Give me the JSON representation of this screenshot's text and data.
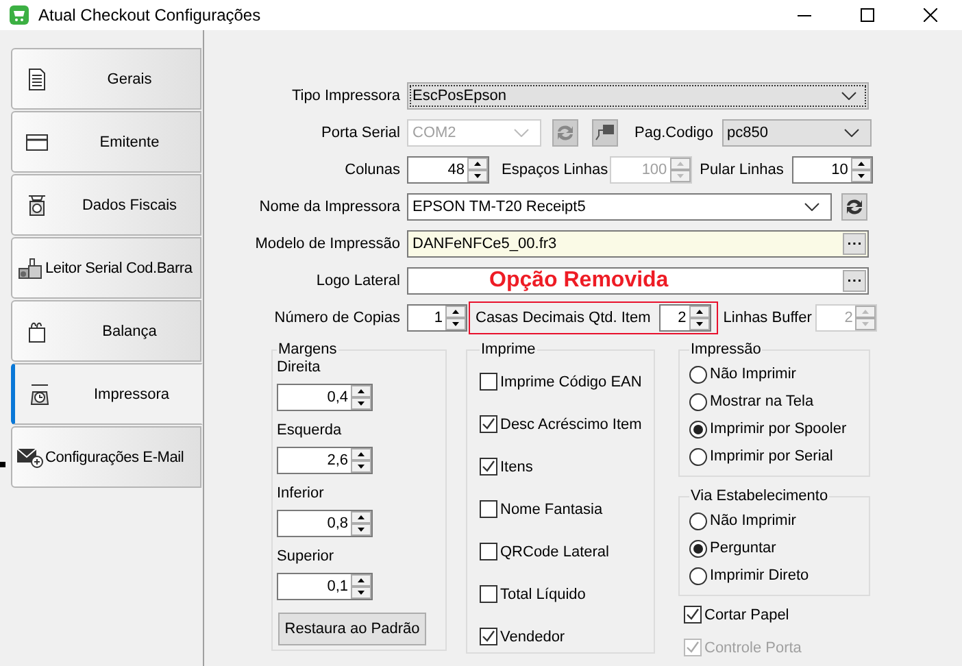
{
  "window": {
    "title": "Atual Checkout Configurações"
  },
  "sidebar": {
    "items": [
      {
        "label": "Gerais",
        "selected": false
      },
      {
        "label": "Emitente",
        "selected": false
      },
      {
        "label": "Dados Fiscais",
        "selected": false
      },
      {
        "label": "Leitor Serial Cod.Barra",
        "selected": false
      },
      {
        "label": "Balança",
        "selected": false
      },
      {
        "label": "Impressora",
        "selected": true
      },
      {
        "label": "Configurações E-Mail",
        "selected": false
      }
    ]
  },
  "printer_type": {
    "label": "Tipo Impressora",
    "value": "EscPosEpson",
    "kind": "list",
    "disabled": false
  },
  "serial_port": {
    "label": "Porta Serial",
    "value": "COM2",
    "disabled": true
  },
  "code_page": {
    "label": "Pag.Codigo",
    "value": "pc850",
    "kind": "list",
    "disabled": false
  },
  "columns": {
    "label": "Colunas",
    "value": "48",
    "disabled": false
  },
  "line_spacing": {
    "label": "Espaços Linhas",
    "value": "100",
    "disabled": true
  },
  "skip_lines": {
    "label": "Pular Linhas",
    "value": "10",
    "disabled": false
  },
  "printer_name": {
    "label": "Nome da Impressora",
    "value": "EPSON TM-T20 Receipt5",
    "kind": "edit",
    "disabled": false
  },
  "print_model": {
    "label": "Modelo de Impressão",
    "value": "DANFeNFCe5_00.fr3"
  },
  "side_logo": {
    "label": "Logo Lateral",
    "annotation": "Opção Removida"
  },
  "copies": {
    "label": "Número de Copias",
    "value": "1",
    "disabled": false
  },
  "item_decimals": {
    "label": "Casas Decimais Qtd. Item",
    "value": "2",
    "disabled": false,
    "highlighted": true
  },
  "buffer_lines": {
    "label": "Linhas Buffer",
    "value": "2",
    "disabled": true
  },
  "margins": {
    "title": "Margens",
    "items": [
      {
        "label": "Direita",
        "value": "0,4"
      },
      {
        "label": "Esquerda",
        "value": "2,6"
      },
      {
        "label": "Inferior",
        "value": "0,8"
      },
      {
        "label": "Superior",
        "value": "0,1"
      }
    ],
    "reset_button": "Restaura ao Padrão"
  },
  "print_options": {
    "title": "Imprime",
    "items": [
      {
        "label": "Imprime Código EAN",
        "checked": false
      },
      {
        "label": "Desc Acréscimo Item",
        "checked": true
      },
      {
        "label": "Itens",
        "checked": true
      },
      {
        "label": "Nome Fantasia",
        "checked": false
      },
      {
        "label": "QRCode Lateral",
        "checked": false
      },
      {
        "label": "Total Líquido",
        "checked": false
      },
      {
        "label": "Vendedor",
        "checked": true
      }
    ]
  },
  "printing": {
    "title": "Impressão",
    "options": [
      {
        "label": "Não Imprimir",
        "selected": false
      },
      {
        "label": "Mostrar na Tela",
        "selected": false
      },
      {
        "label": "Imprimir por Spooler",
        "selected": true
      },
      {
        "label": "Imprimir por Serial",
        "selected": false
      }
    ]
  },
  "establishment_copy": {
    "title": "Via Estabelecimento",
    "options": [
      {
        "label": "Não Imprimir",
        "selected": false
      },
      {
        "label": "Perguntar",
        "selected": true
      },
      {
        "label": "Imprimir Direto",
        "selected": false
      }
    ]
  },
  "extra_options": [
    {
      "label": "Cortar Papel",
      "checked": true,
      "disabled": false
    },
    {
      "label": "Controle Porta",
      "checked": true,
      "disabled": true
    }
  ]
}
